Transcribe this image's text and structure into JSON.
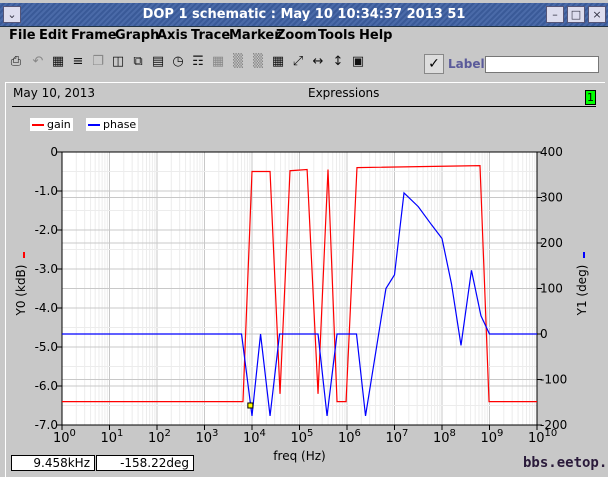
{
  "window": {
    "title": "DOP 1 schematic : May 10 10:34:37 2013 51"
  },
  "menu": [
    "File",
    "Edit",
    "Frame",
    "Graph",
    "Axis",
    "Trace",
    "Marker",
    "Zoom",
    "Tools",
    "Help"
  ],
  "toolbar": {
    "label": "Label",
    "label_value": ""
  },
  "header": {
    "date": "May 10, 2013",
    "title": "Expressions",
    "badge": "1"
  },
  "legend": [
    {
      "name": "gain",
      "color": "#ff0000"
    },
    {
      "name": "phase",
      "color": "#0000ff"
    }
  ],
  "status": {
    "x": "9.458kHz",
    "y": "-158.22deg"
  },
  "watermark": "bbs.eetop.cn",
  "chart_data": {
    "type": "line",
    "xlabel": "freq (Hz)",
    "xscale": "log",
    "xlim": [
      1,
      10000000000.0
    ],
    "xticks": [
      "10",
      "10",
      "10",
      "10",
      "10",
      "10",
      "10",
      "10",
      "10",
      "10",
      "10"
    ],
    "xtick_exps": [
      "0",
      "1",
      "2",
      "3",
      "4",
      "5",
      "6",
      "7",
      "8",
      "9",
      "10"
    ],
    "ylabel_left": "Y0 (kdB)",
    "ylim_left": [
      -7,
      0
    ],
    "yticks_left": [
      "0",
      "-1.0",
      "-2.0",
      "-3.0",
      "-4.0",
      "-5.0",
      "-6.0",
      "-7.0"
    ],
    "ylabel_right": "Y1 (deg)",
    "ylim_right": [
      -200,
      400
    ],
    "yticks_right": [
      "400",
      "300",
      "200",
      "100",
      "0",
      "-100",
      "-200"
    ],
    "grid": true,
    "series": [
      {
        "name": "gain",
        "axis": "left",
        "color": "#ff0000",
        "log10_x": [
          0,
          3.81,
          4.0,
          4.38,
          4.59,
          4.8,
          5.16,
          5.39,
          5.6,
          5.79,
          5.98,
          6.21,
          8.8,
          8.99,
          10
        ],
        "y": [
          -6.4,
          -6.4,
          -0.5,
          -0.5,
          -6.2,
          -0.48,
          -0.45,
          -6.2,
          -0.45,
          -6.4,
          -6.4,
          -0.4,
          -0.35,
          -6.4,
          -6.4
        ]
      },
      {
        "name": "phase",
        "axis": "right",
        "color": "#0000ff",
        "log10_x": [
          0,
          3.78,
          4.0,
          4.18,
          4.38,
          4.58,
          5.39,
          5.58,
          5.79,
          6.2,
          6.39,
          6.82,
          7.0,
          7.2,
          7.5,
          7.78,
          8.0,
          8.2,
          8.4,
          8.62,
          8.82,
          9.0,
          10
        ],
        "y": [
          0,
          0,
          -180,
          0,
          -180,
          0,
          0,
          -180,
          0,
          0,
          -180,
          100,
          130,
          310,
          280,
          240,
          210,
          110,
          -25,
          140,
          40,
          0,
          0
        ]
      }
    ],
    "marker": {
      "x": "9.458kHz",
      "y": -158.22
    }
  }
}
